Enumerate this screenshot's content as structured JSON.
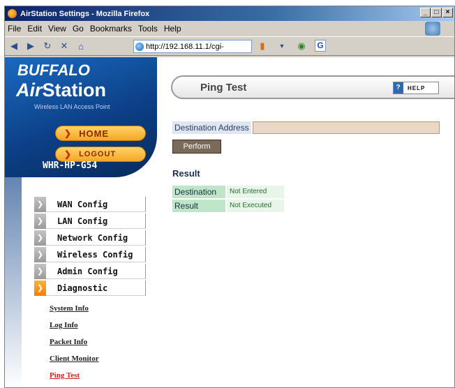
{
  "window": {
    "title": "AirStation Settings - Mozilla Firefox",
    "controls": {
      "minimize": "_",
      "maximize": "□",
      "close": "×"
    }
  },
  "menubar": [
    "File",
    "Edit",
    "View",
    "Go",
    "Bookmarks",
    "Tools",
    "Help"
  ],
  "toolbar": {
    "url": "http://192.168.11.1/cgi-",
    "search_engine_letter": "G"
  },
  "sidebar": {
    "brand": "BUFFALO",
    "product_air": "Air",
    "product_station": "Station",
    "tagline": "Wireless LAN Access Point",
    "home_label": "HOME",
    "logout_label": "LOGOUT",
    "model": "WHR-HP-G54",
    "config_items": [
      {
        "label": "WAN Config",
        "active": false
      },
      {
        "label": "LAN Config",
        "active": false
      },
      {
        "label": "Network Config",
        "active": false
      },
      {
        "label": "Wireless Config",
        "active": false
      },
      {
        "label": "Admin Config",
        "active": false
      },
      {
        "label": "Diagnostic",
        "active": true
      }
    ],
    "sub_items": [
      {
        "label": "System Info",
        "active": false
      },
      {
        "label": "Log Info",
        "active": false
      },
      {
        "label": "Packet Info",
        "active": false
      },
      {
        "label": "Client Monitor",
        "active": false
      },
      {
        "label": "Ping Test",
        "active": true
      }
    ]
  },
  "main": {
    "page_title": "Ping Test",
    "help_label": "HELP",
    "destination_label": "Destination Address",
    "destination_value": "",
    "perform_label": "Perform",
    "result_heading": "Result",
    "results": [
      {
        "key": "Destination",
        "value": "Not Entered"
      },
      {
        "key": "Result",
        "value": "Not Executed"
      }
    ]
  }
}
